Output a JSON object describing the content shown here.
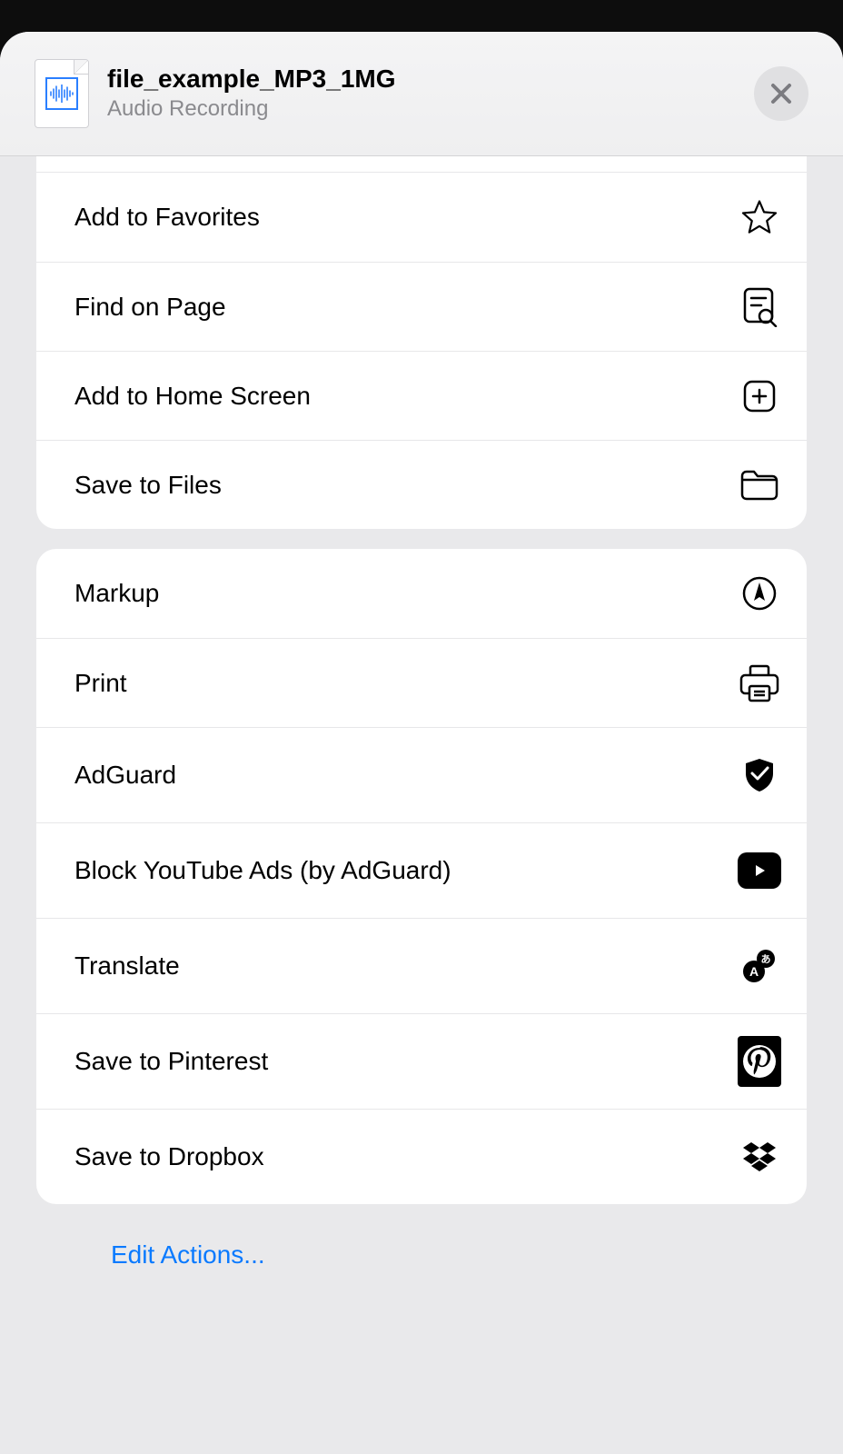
{
  "header": {
    "filename": "file_example_MP3_1MG",
    "subtitle": "Audio Recording"
  },
  "group1": {
    "items": [
      {
        "label": "Add to Favorites"
      },
      {
        "label": "Find on Page"
      },
      {
        "label": "Add to Home Screen"
      },
      {
        "label": "Save to Files"
      }
    ]
  },
  "group2": {
    "items": [
      {
        "label": "Markup"
      },
      {
        "label": "Print"
      },
      {
        "label": "AdGuard"
      },
      {
        "label": "Block YouTube Ads (by AdGuard)"
      },
      {
        "label": "Translate"
      },
      {
        "label": "Save to Pinterest"
      },
      {
        "label": "Save to Dropbox"
      }
    ]
  },
  "footer": {
    "edit_label": "Edit Actions..."
  }
}
